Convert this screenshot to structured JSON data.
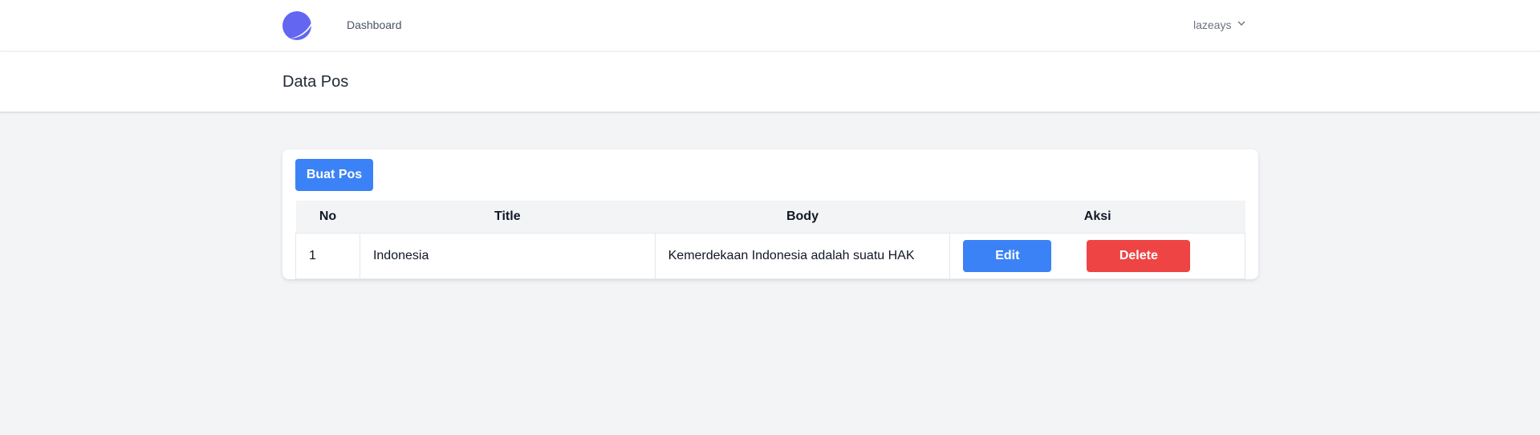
{
  "nav": {
    "link_dashboard": "Dashboard",
    "username": "lazeays"
  },
  "header": {
    "title": "Data Pos"
  },
  "actions": {
    "create_label": "Buat Pos"
  },
  "table": {
    "headers": {
      "no": "No",
      "title": "Title",
      "body": "Body",
      "aksi": "Aksi"
    },
    "rows": [
      {
        "no": "1",
        "title": "Indonesia",
        "body": "Kemerdekaan Indonesia adalah suatu HAK",
        "edit_label": "Edit",
        "delete_label": "Delete"
      }
    ]
  },
  "colors": {
    "primary": "#3b82f6",
    "danger": "#ef4444",
    "logo": "#6366f1",
    "background": "#f3f4f6"
  },
  "icons": {
    "logo": "app-logo-icon",
    "user_dropdown": "chevron-down-icon"
  }
}
